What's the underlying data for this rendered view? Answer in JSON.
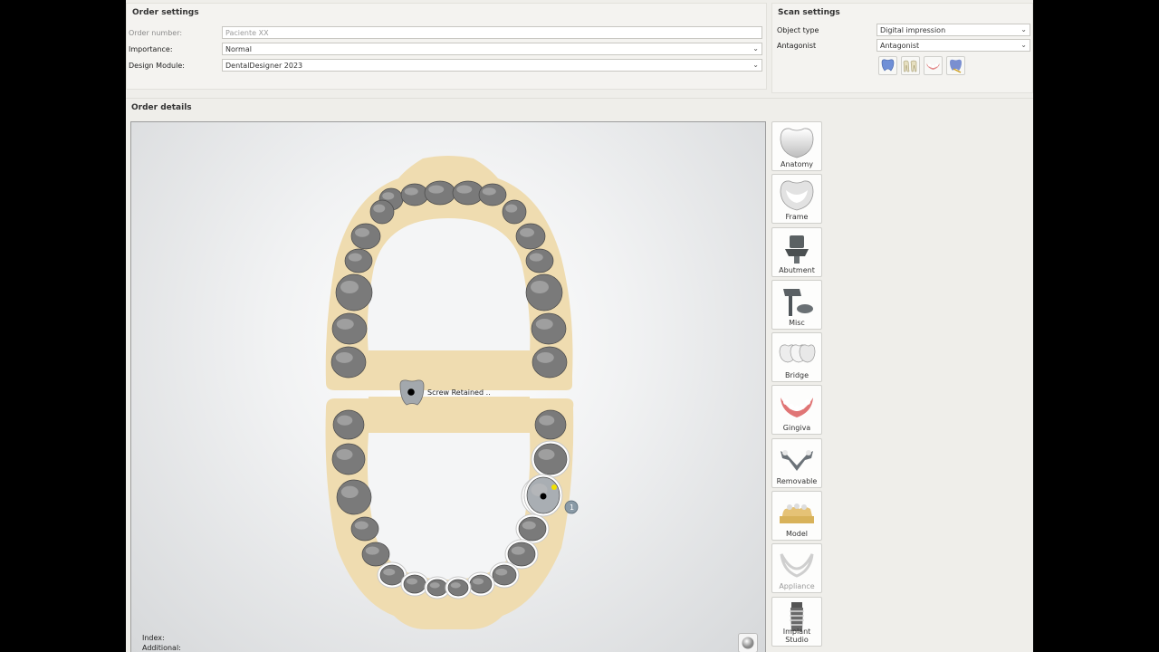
{
  "order_settings": {
    "title": "Order settings",
    "order_number": {
      "label": "Order number:",
      "value": "Paciente XX"
    },
    "importance": {
      "label": "Importance:",
      "value": "Normal"
    },
    "design_module": {
      "label": "Design Module:",
      "value": "DentalDesigner 2023"
    }
  },
  "scan_settings": {
    "title": "Scan settings",
    "object_type": {
      "label": "Object type",
      "value": "Digital impression"
    },
    "antagonist": {
      "label": "Antagonist",
      "value": "Antagonist"
    },
    "antagonist_icons": [
      "tooth-blue-icon",
      "tooth-pair-icon",
      "gingiva-icon",
      "tooth-scan-icon"
    ]
  },
  "order_details": {
    "title": "Order details",
    "implant_tag": "Screw Retained ..",
    "index_label": "Index:",
    "additional_label": "Additional:",
    "marker_number": "1"
  },
  "palette": [
    {
      "label": "Anatomy",
      "icon": "anatomy-crown-icon",
      "enabled": true
    },
    {
      "label": "Frame",
      "icon": "frame-crown-icon",
      "enabled": true
    },
    {
      "label": "Abutment",
      "icon": "abutment-icon",
      "enabled": true
    },
    {
      "label": "Misc",
      "icon": "misc-post-icon",
      "enabled": true
    },
    {
      "label": "Bridge",
      "icon": "bridge-icon",
      "enabled": true
    },
    {
      "label": "Gingiva",
      "icon": "gingiva-icon",
      "enabled": true
    },
    {
      "label": "Removable",
      "icon": "removable-frame-icon",
      "enabled": true
    },
    {
      "label": "Model",
      "icon": "model-icon",
      "enabled": true
    },
    {
      "label": "Appliance",
      "icon": "appliance-icon",
      "enabled": false
    },
    {
      "label": "Implant Studio",
      "icon": "implant-icon",
      "enabled": true
    }
  ],
  "colors": {
    "arch_fill": "#efdcb0",
    "tooth_fill": "#7a7a7a",
    "tooth_selected_fill": "#a9aeb3",
    "tooth_selected_outline": "#ffffff",
    "marker_yellow": "#f0e000"
  }
}
